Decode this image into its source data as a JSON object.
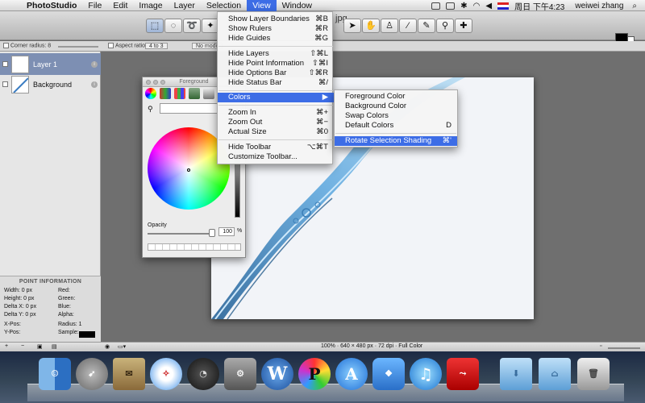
{
  "menubar": {
    "apple_glyph": "",
    "app_name": "PhotoStudio",
    "items": [
      "File",
      "Edit",
      "Image",
      "Layer",
      "Selection",
      "View",
      "Window"
    ],
    "active_item": "View",
    "clock": "周日 下午4:23",
    "user": "weiwei zhang"
  },
  "toolbar": {
    "title_fragment": "jpg"
  },
  "options_bar": {
    "corner_radius_label": "Corner radius: 8",
    "aspect_ratio_label": "Aspect ratio:",
    "aspect_ratio_value": "4 to 3",
    "modifier_value": "No modif"
  },
  "layers": {
    "items": [
      {
        "name": "Layer 1",
        "selected": true
      },
      {
        "name": "Background",
        "selected": false
      }
    ]
  },
  "point_info": {
    "header": "POINT INFORMATION",
    "width": "Width:  0 px",
    "height": "Height:  0 px",
    "delta_x": "Delta X:  0 px",
    "delta_y": "Delta Y:  0 px",
    "x_pos": "X-Pos:",
    "y_pos": "Y-Pos:",
    "red": "Red:",
    "green": "Green:",
    "blue": "Blue:",
    "alpha": "Alpha:",
    "radius": "Radius:    1",
    "sample": "Sample:"
  },
  "foreground_panel": {
    "title": "Foreground",
    "opacity_label": "Opacity",
    "opacity_value": "100",
    "opacity_unit": "%"
  },
  "view_menu": {
    "items": [
      {
        "label": "Show Layer Boundaries",
        "shortcut": "⌘B"
      },
      {
        "label": "Show Rulers",
        "shortcut": "⌘R"
      },
      {
        "label": "Hide Guides",
        "shortcut": "⌘G"
      },
      {
        "label": "Hide Layers",
        "shortcut": "⇧⌘L"
      },
      {
        "label": "Hide Point Information",
        "shortcut": "⇧⌘I"
      },
      {
        "label": "Hide Options Bar",
        "shortcut": "⇧⌘R"
      },
      {
        "label": "Hide Status Bar",
        "shortcut": "⌘/"
      },
      {
        "label": "Colors",
        "shortcut": "▶"
      },
      {
        "label": "Zoom In",
        "shortcut": "⌘+"
      },
      {
        "label": "Zoom Out",
        "shortcut": "⌘−"
      },
      {
        "label": "Actual Size",
        "shortcut": "⌘0"
      },
      {
        "label": "Hide Toolbar",
        "shortcut": "⌥⌘T"
      },
      {
        "label": "Customize Toolbar...",
        "shortcut": ""
      }
    ],
    "highlighted": "Colors"
  },
  "colors_menu": {
    "items": [
      {
        "label": "Foreground Color",
        "shortcut": ""
      },
      {
        "label": "Background Color",
        "shortcut": ""
      },
      {
        "label": "Swap Colors",
        "shortcut": ""
      },
      {
        "label": "Default Colors",
        "shortcut": "D"
      },
      {
        "label": "Rotate Selection Shading",
        "shortcut": "⌘'"
      }
    ],
    "highlighted": "Rotate Selection Shading"
  },
  "status_bar": {
    "info": "100% · 640 × 480 px · 72 dpi · Full Color"
  },
  "dock": {
    "icons": [
      "finder-icon",
      "launchpad-icon",
      "mail-icon",
      "safari-icon",
      "dashboard-icon",
      "system-preferences-icon",
      "word-icon",
      "photostudio-icon",
      "app-store-icon",
      "dropbox-icon",
      "itunes-icon",
      "acrobat-icon",
      "documents-folder-icon",
      "applications-folder-icon",
      "trash-icon"
    ]
  },
  "colors": {
    "menu_highlight": "#3d6de6",
    "selected_layer": "#7d8fb3",
    "splash_blue": "#2d7ab8"
  }
}
